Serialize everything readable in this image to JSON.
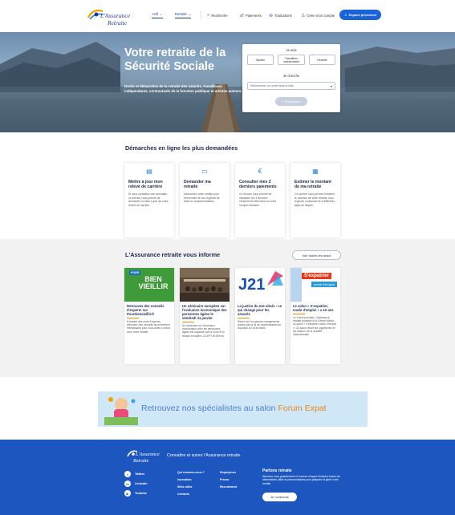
{
  "header": {
    "logo_line1": "L'Assurance",
    "logo_line2": "Retraite",
    "tabs": [
      {
        "label": "Actif",
        "chevron": "⌄"
      },
      {
        "label": "Retraité",
        "chevron": "⌄"
      }
    ],
    "nav": [
      {
        "label": "Recherche",
        "icon": "search-icon",
        "glyph": "⌕"
      },
      {
        "label": "Paiements",
        "icon": "payments-icon",
        "glyph": "⇄"
      },
      {
        "label": "Traductions",
        "icon": "globe-icon",
        "glyph": "⊕"
      },
      {
        "label": "Créer mon compte",
        "icon": "user-add-icon",
        "glyph": "♙"
      }
    ],
    "space_button": {
      "label": "Espace personnel",
      "glyph": "♙"
    }
  },
  "hero": {
    "title": "Votre retraite de la Sécurité Sociale",
    "subtitle": "Droits et démarches de la retraite des salariés, travailleurs indépendants, contractuels de la fonction publique et artistes auteurs.",
    "je_suis": "Je suis",
    "options": [
      "Salarié",
      "Travailleur indépendant",
      "Retraité"
    ],
    "je_cherche": "Je cherche",
    "select_placeholder": "Sélectionner un motif dans la liste",
    "select_caret": "▾",
    "submit": "Rechercher",
    "submit_glyph": "⌕"
  },
  "demarches": {
    "title": "Démarches en ligne les plus demandées",
    "cards": [
      {
        "icon": "document-icon",
        "glyph": "▤",
        "title": "Mettre à jour mon relevé de carrière",
        "text": "Si vous constatez une anomalie, ce service vous permet de demander la mise à jour de votre relevé de carrière."
      },
      {
        "icon": "computer-icon",
        "glyph": "▭",
        "title": "Demander ma retraite",
        "text": "Demandez votre retraite pour l'ensemble de vos régimes de base et complémentaires."
      },
      {
        "icon": "euro-icon",
        "glyph": "€",
        "title": "Consulter mes 3 derniers paiements",
        "text": "Ce service vous permet de visualiser les 3 derniers versements effectués sur votre compte bancaire."
      },
      {
        "icon": "calculator-icon",
        "glyph": "▦",
        "title": "Estimer le montant de ma retraite",
        "text": "Ce service vous permet d'estimer le montant de votre retraite, tous régimes confondus et à différents âges de départ."
      }
    ]
  },
  "news": {
    "title": "L'Assurance retraite vous informe",
    "all_button": "Voir toutes les actus",
    "cards": [
      {
        "image_text_top": "POUR",
        "image_text_main": "BIEN VIEILLIR",
        "title": "Retrouvez des conseils d'experts sur Pourbienvieillir.fr",
        "text": "À travers des mots d'experts, retrouvez des conseils de prévention thématiques pour vous aider à mieux vivre votre retraite."
      },
      {
        "title": "Un séminaire européen sur l'exclusion économique des personnes âgées le vendredi 31 janvier",
        "text": "Un séminaire sur l'exclusion économique chez les personnes âgées est organisé par la Cnav et le réseau européen CCEPT-ROSEnet."
      },
      {
        "image_text_main": "J21",
        "title": "La justice du 21e siècle : ce qui change pour les assurés",
        "text": "Retour sur les grands changements prévus par la loi de modernisation de la justice du XXIe siècle."
      },
      {
        "image_text_top": "S'expatrier",
        "image_text_main": "mode d'emploi",
        "title": "Le salon « S'expatrier, mode d'emploi » a 10 ans",
        "text": "Le 5 avril prochain, l'Assurance retraite participe à la 10ème édition du salon « S'expatrier mode d'emploi ». Ce salon réunit les organismes et les acteurs de la mobilité internationale."
      }
    ]
  },
  "banner": {
    "text": "Retrouvez nos spécialistes au salon",
    "accent": "Forum Expat"
  },
  "footer": {
    "logo_line1": "L'Assurance",
    "logo_line2": "Retraite",
    "tagline": "Connaître et suivre l'Assurance retraite",
    "social": [
      {
        "label": "Twitter",
        "icon": "twitter-icon",
        "glyph": "t"
      },
      {
        "label": "LinkedIn",
        "icon": "linkedin-icon",
        "glyph": "in"
      },
      {
        "label": "Youtube",
        "icon": "youtube-icon",
        "glyph": "▶"
      }
    ],
    "links_col1": [
      "Qui sommes-nous ?",
      "Innovation",
      "Sites utiles",
      "Contacts"
    ],
    "links_col2": [
      "Employeurs",
      "Presse",
      "Recrutement"
    ],
    "newsletter_title": "Parlons retraite",
    "newsletter_text": "Abonnez-vous gratuitement et recevez chaque trimestre toutes les informations utiles et personnalisées pour préparer et gérer votre retraite.",
    "newsletter_button": "Je m'abonne"
  },
  "colors": {
    "primary": "#1b64d8",
    "footer": "#1e56bf",
    "accent": "#f08a00",
    "navy": "#1c2a4a"
  }
}
